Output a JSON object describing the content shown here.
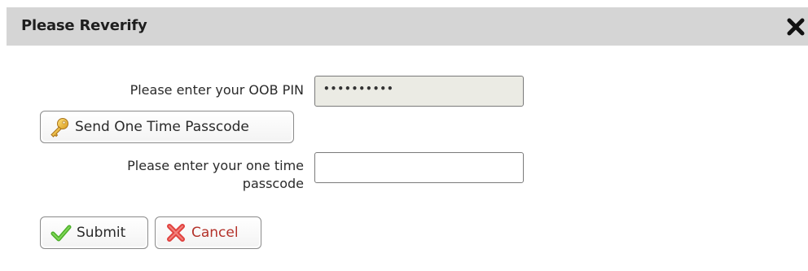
{
  "dialog": {
    "title": "Please Reverify",
    "close_icon": "close-icon"
  },
  "form": {
    "pin_label": "Please enter your OOB PIN",
    "pin_value": "••••••••••",
    "send_button_label": "Send One Time Passcode",
    "send_button_icon": "key-icon",
    "otp_label_line1": "Please enter your one time",
    "otp_label_line2": "passcode",
    "otp_value": ""
  },
  "actions": {
    "submit_label": "Submit",
    "submit_icon": "checkmark-icon",
    "cancel_label": "Cancel",
    "cancel_icon": "x-icon"
  },
  "colors": {
    "titlebar_bg": "#d5d5d5",
    "disabled_input_bg": "#ebebe4",
    "submit_check": "#4caf2a",
    "cancel_x": "#e0413e",
    "cancel_text": "#c0392b"
  }
}
